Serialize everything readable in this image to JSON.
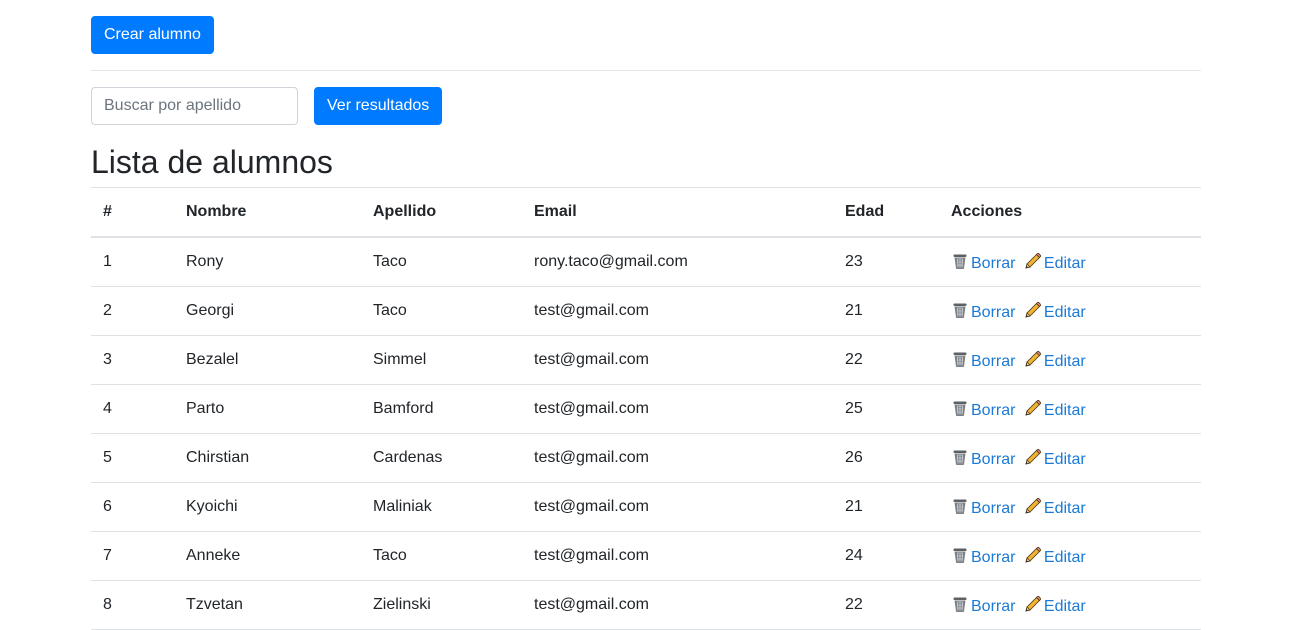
{
  "toolbar": {
    "create_label": "Crear alumno",
    "search_placeholder": "Buscar por apellido",
    "search_value": "",
    "search_button_label": "Ver resultados"
  },
  "page_title": "Lista de alumnos",
  "table": {
    "headers": [
      "#",
      "Nombre",
      "Apellido",
      "Email",
      "Edad",
      "Acciones"
    ],
    "rows": [
      {
        "num": "1",
        "nombre": "Rony",
        "apellido": "Taco",
        "email": "rony.taco@gmail.com",
        "edad": "23"
      },
      {
        "num": "2",
        "nombre": "Georgi",
        "apellido": "Taco",
        "email": "test@gmail.com",
        "edad": "21"
      },
      {
        "num": "3",
        "nombre": "Bezalel",
        "apellido": "Simmel",
        "email": "test@gmail.com",
        "edad": "22"
      },
      {
        "num": "4",
        "nombre": "Parto",
        "apellido": "Bamford",
        "email": "test@gmail.com",
        "edad": "25"
      },
      {
        "num": "5",
        "nombre": "Chirstian",
        "apellido": "Cardenas",
        "email": "test@gmail.com",
        "edad": "26"
      },
      {
        "num": "6",
        "nombre": "Kyoichi",
        "apellido": "Maliniak",
        "email": "test@gmail.com",
        "edad": "21"
      },
      {
        "num": "7",
        "nombre": "Anneke",
        "apellido": "Taco",
        "email": "test@gmail.com",
        "edad": "24"
      },
      {
        "num": "8",
        "nombre": "Tzvetan",
        "apellido": "Zielinski",
        "email": "test@gmail.com",
        "edad": "22"
      }
    ],
    "delete_label": "Borrar",
    "edit_label": "Editar",
    "delete_icon": "wastebasket-icon",
    "edit_icon": "pencil-icon"
  },
  "colors": {
    "primary": "#007bff",
    "link": "#1a7ad6",
    "text": "#212529",
    "border": "#dee2e6"
  }
}
